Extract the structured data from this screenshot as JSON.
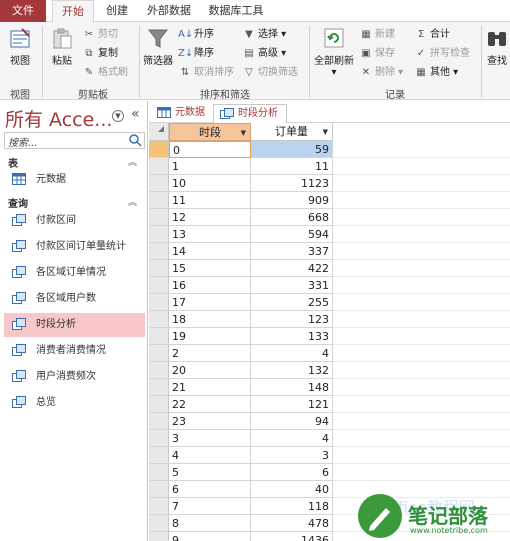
{
  "ribbon_tabs": [
    "文件",
    "开始",
    "创建",
    "外部数据",
    "数据库工具"
  ],
  "active_tab": "开始",
  "ribbon": {
    "view_group": {
      "label": "视图",
      "button": "视图"
    },
    "clipboard_group": {
      "label": "剪贴板",
      "paste": "粘贴",
      "cut": "剪切",
      "copy": "复制",
      "format_painter": "格式刷"
    },
    "sort_filter_group": {
      "label": "排序和筛选",
      "filter": "筛选器",
      "ascending": "升序",
      "descending": "降序",
      "remove_sort": "取消排序",
      "selection": "选择",
      "advanced": "高级",
      "toggle_filter": "切换筛选"
    },
    "records_group": {
      "label": "记录",
      "refresh_all": "全部刷新",
      "new": "新建",
      "save": "保存",
      "delete": "删除",
      "totals": "合计",
      "spelling": "拼写检查",
      "more": "其他"
    },
    "find_group": {
      "find": "查找"
    }
  },
  "nav": {
    "title": "所有 Acce...",
    "search_placeholder": "搜索...",
    "tables_header": "表",
    "tables": [
      "元数据"
    ],
    "queries_header": "查询",
    "queries": [
      "付款区间",
      "付款区间订单量统计",
      "各区域订单情况",
      "各区域用户数",
      "时段分析",
      "消费者消费情况",
      "用户消费频次",
      "总览"
    ],
    "selected_query": "时段分析"
  },
  "doc_tabs": [
    {
      "label": "元数据",
      "active": false
    },
    {
      "label": "时段分析",
      "active": true
    }
  ],
  "datasheet": {
    "columns": [
      "时段",
      "订单量"
    ],
    "rows": [
      [
        "0",
        "59"
      ],
      [
        "1",
        "11"
      ],
      [
        "10",
        "1123"
      ],
      [
        "11",
        "909"
      ],
      [
        "12",
        "668"
      ],
      [
        "13",
        "594"
      ],
      [
        "14",
        "337"
      ],
      [
        "15",
        "422"
      ],
      [
        "16",
        "331"
      ],
      [
        "17",
        "255"
      ],
      [
        "18",
        "123"
      ],
      [
        "19",
        "133"
      ],
      [
        "2",
        "4"
      ],
      [
        "20",
        "132"
      ],
      [
        "21",
        "148"
      ],
      [
        "22",
        "121"
      ],
      [
        "23",
        "94"
      ],
      [
        "3",
        "4"
      ],
      [
        "4",
        "3"
      ],
      [
        "5",
        "6"
      ],
      [
        "6",
        "40"
      ],
      [
        "7",
        "118"
      ],
      [
        "8",
        "478"
      ],
      [
        "9",
        "1436"
      ]
    ]
  },
  "watermark": {
    "text": "笔记部落",
    "url": "www.notetribe.com",
    "faint": "Office教程网"
  },
  "colors": {
    "accent": "#a4373a",
    "selected_nav": "#f7c7c9",
    "selected_cell": "#b9d3ee"
  }
}
